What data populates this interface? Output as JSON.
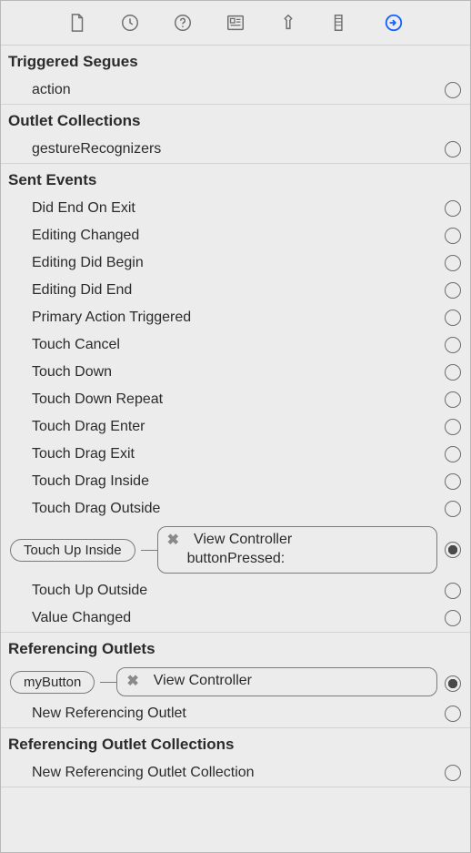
{
  "toolbar": {
    "icons": [
      "file",
      "history",
      "help",
      "identity",
      "attributes",
      "size",
      "connections"
    ],
    "active": "connections"
  },
  "sections": {
    "triggeredSegues": {
      "title": "Triggered Segues",
      "items": [
        {
          "label": "action"
        }
      ]
    },
    "outletCollections": {
      "title": "Outlet Collections",
      "items": [
        {
          "label": "gestureRecognizers"
        }
      ]
    },
    "sentEvents": {
      "title": "Sent Events",
      "items": [
        {
          "label": "Did End On Exit"
        },
        {
          "label": "Editing Changed"
        },
        {
          "label": "Editing Did Begin"
        },
        {
          "label": "Editing Did End"
        },
        {
          "label": "Primary Action Triggered"
        },
        {
          "label": "Touch Cancel"
        },
        {
          "label": "Touch Down"
        },
        {
          "label": "Touch Down Repeat"
        },
        {
          "label": "Touch Drag Enter"
        },
        {
          "label": "Touch Drag Exit"
        },
        {
          "label": "Touch Drag Inside"
        },
        {
          "label": "Touch Drag Outside"
        }
      ],
      "touchUpInside": {
        "pill": "Touch Up Inside",
        "target": "View Controller",
        "selector": "buttonPressed:"
      },
      "tail": [
        {
          "label": "Touch Up Outside"
        },
        {
          "label": "Value Changed"
        }
      ]
    },
    "referencingOutlets": {
      "title": "Referencing Outlets",
      "myButton": {
        "pill": "myButton",
        "target": "View Controller"
      },
      "items": [
        {
          "label": "New Referencing Outlet"
        }
      ]
    },
    "referencingOutletCollections": {
      "title": "Referencing Outlet Collections",
      "items": [
        {
          "label": "New Referencing Outlet Collection"
        }
      ]
    }
  }
}
